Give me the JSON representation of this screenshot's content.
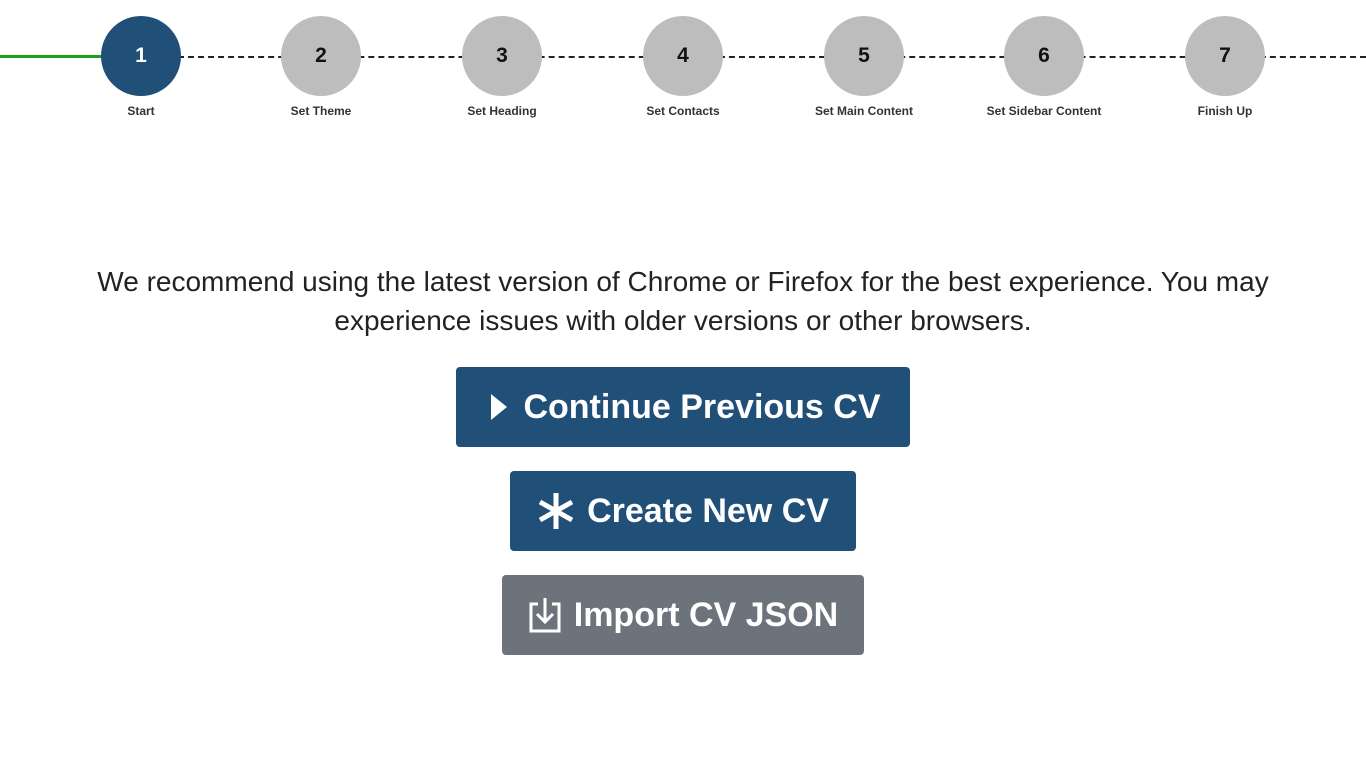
{
  "stepper": {
    "colors": {
      "active": "#204f78",
      "inactive": "#bdbdbd",
      "progress": "#1aa01a"
    },
    "steps": [
      {
        "number": "1",
        "label": "Start"
      },
      {
        "number": "2",
        "label": "Set Theme"
      },
      {
        "number": "3",
        "label": "Set Heading"
      },
      {
        "number": "4",
        "label": "Set Contacts"
      },
      {
        "number": "5",
        "label": "Set Main Content"
      },
      {
        "number": "6",
        "label": "Set Sidebar Content"
      },
      {
        "number": "7",
        "label": "Finish Up"
      }
    ]
  },
  "notice": {
    "text": "We recommend using the latest version of Chrome or Firefox for the best experience. You may experience issues with older versions or other browsers."
  },
  "actions": {
    "continue": {
      "label": "Continue Previous CV",
      "icon": "play-icon",
      "color": "#204f78"
    },
    "create": {
      "label": "Create New CV",
      "icon": "asterisk-icon",
      "color": "#204f78"
    },
    "import": {
      "label": "Import CV JSON",
      "icon": "download-icon",
      "color": "#6c737b"
    }
  }
}
